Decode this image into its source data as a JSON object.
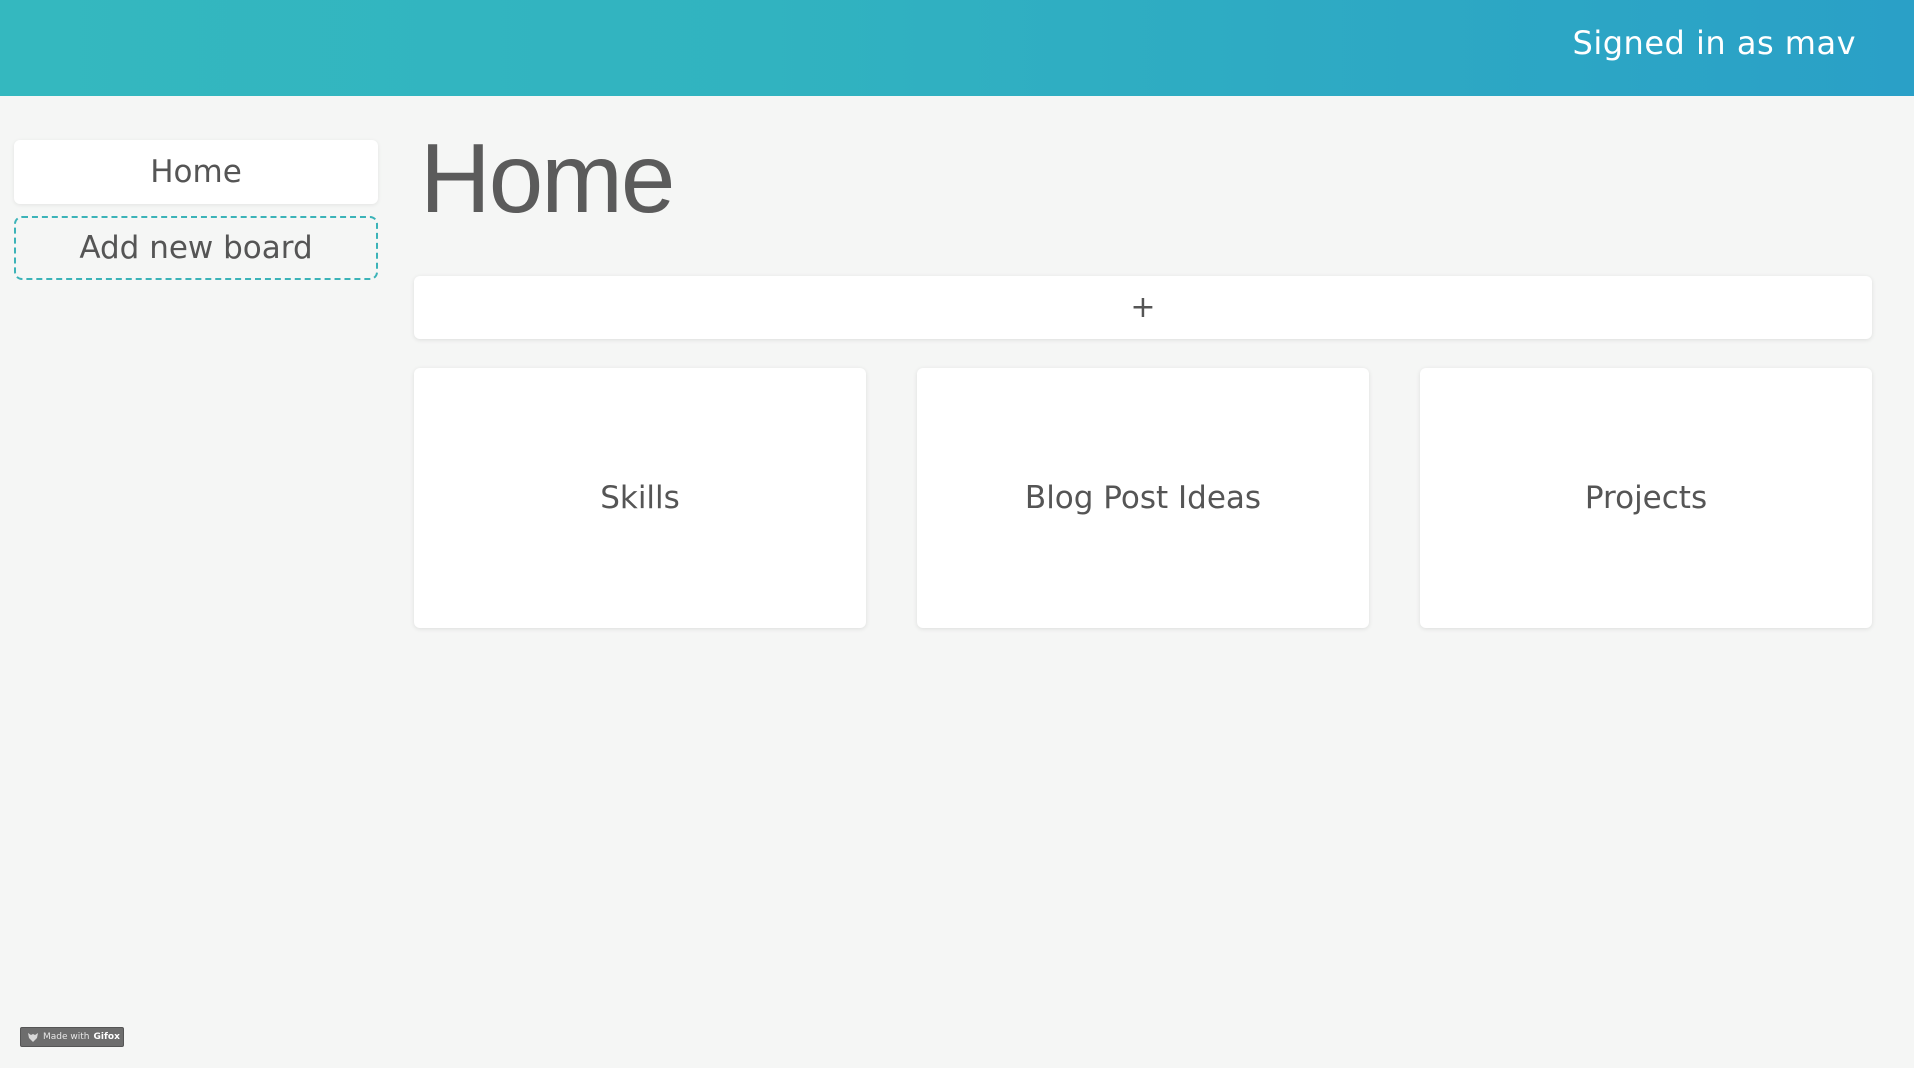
{
  "header": {
    "signed_in_text": "Signed in as mav"
  },
  "sidebar": {
    "items": [
      {
        "label": "Home"
      },
      {
        "label": "Add new board"
      }
    ]
  },
  "main": {
    "title": "Home",
    "add_board_label": "+",
    "boards": [
      {
        "label": "Skills"
      },
      {
        "label": "Blog Post Ideas"
      },
      {
        "label": "Projects"
      }
    ]
  },
  "badge": {
    "prefix": "Made with",
    "brand": "Gifox",
    "icon": "fox-icon"
  },
  "colors": {
    "header_gradient_start": "#34b8bf",
    "header_gradient_end": "#2aa0c7",
    "dashed_accent": "#3bb3b8",
    "background": "#f5f6f5"
  }
}
